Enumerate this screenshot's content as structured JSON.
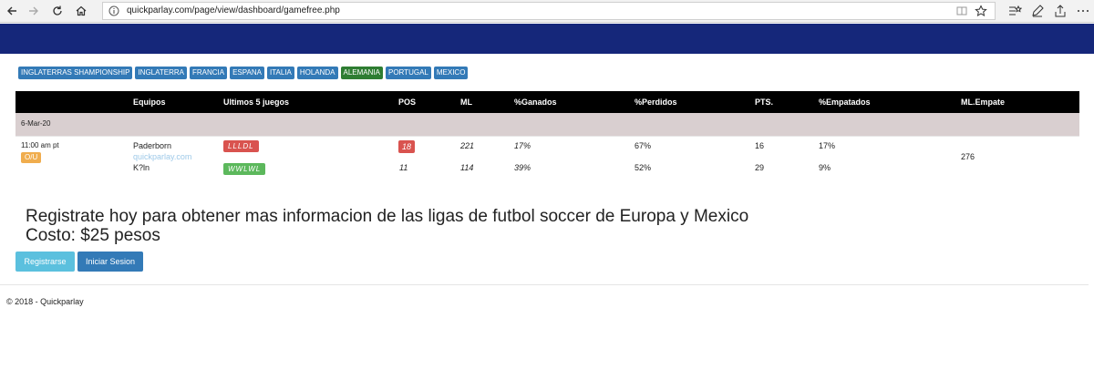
{
  "browser": {
    "url": "quickparlay.com/page/view/dashboard/gamefree.php"
  },
  "leagues": [
    {
      "label": "INGLATERRAS SHAMPIONSHIP"
    },
    {
      "label": "INGLATERRA"
    },
    {
      "label": "FRANCIA"
    },
    {
      "label": "ESPANA"
    },
    {
      "label": "ITALIA"
    },
    {
      "label": "HOLANDA"
    },
    {
      "label": "ALEMANIA"
    },
    {
      "label": "PORTUGAL"
    },
    {
      "label": "MEXICO"
    }
  ],
  "table": {
    "headers": {
      "equipos": "Equipos",
      "ultimos": "Ultimos 5 juegos",
      "pos": "POS",
      "ml": "ML",
      "ganados": "%Ganados",
      "perdidos": "%Perdidos",
      "pts": "PTS.",
      "empatados": "%Empatados",
      "ml_empate": "ML.Empate"
    },
    "date": "6-Mar-20",
    "game": {
      "time": "11:00 am pt",
      "badge": "O/U",
      "watermark": "quickparlay.com",
      "ml_empate": "276",
      "home": {
        "team": "Paderborn",
        "last5": "LLLDL",
        "pos": "18",
        "ml": "221",
        "ganados": "17%",
        "perdidos": "67%",
        "pts": "16",
        "empatados": "17%"
      },
      "away": {
        "team": "K?ln",
        "last5": "WWLWL",
        "pos": "11",
        "ml": "114",
        "ganados": "39%",
        "perdidos": "52%",
        "pts": "29",
        "empatados": "9%"
      }
    }
  },
  "cta": {
    "line1": "Registrate hoy para obtener mas informacion de las ligas de futbol soccer de Europa y Mexico",
    "line2": "Costo: $25 pesos",
    "register_label": "Registrarse",
    "login_label": "Iniciar Sesion"
  },
  "footer": {
    "text": "© 2018 - Quickparlay"
  },
  "colors": {
    "header_navy": "#15277a",
    "primary": "#337ab7",
    "success": "#2e7d32",
    "danger": "#d9534f",
    "info": "#5bc0de",
    "warning": "#f0ad4e"
  }
}
